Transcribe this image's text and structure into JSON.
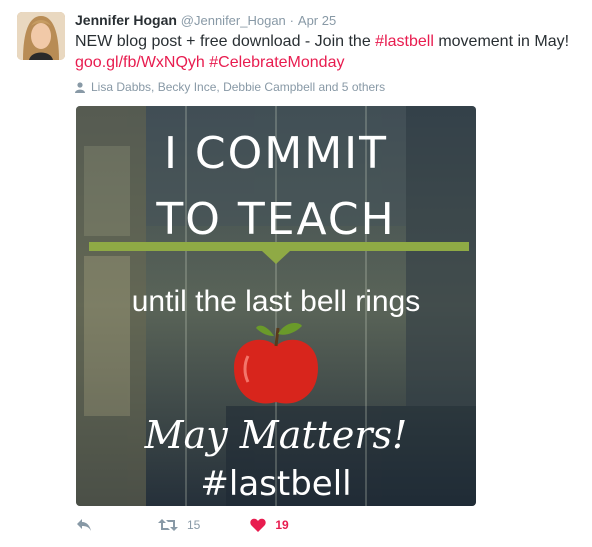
{
  "tweet": {
    "author_name": "Jennifer Hogan",
    "handle": "@Jennifer_Hogan",
    "separator": "·",
    "date": "Apr 25",
    "text_prefix": "NEW blog post + free download - Join the ",
    "hashtag_lastbell": "#lastbell",
    "text_suffix": " movement in May!",
    "link": "goo.gl/fb/WxNQyh",
    "hashtag_celebrate": "#CelebrateMonday",
    "mentioned_users": "Lisa Dabbs, Becky Ince, Debbie Campbell and 5 others"
  },
  "media": {
    "line1": "I COMMIT",
    "line2": "TO TEACH",
    "line3": "until the last bell rings",
    "line4": "May Matters!",
    "line5": "#lastbell"
  },
  "actions": {
    "retweet_count": "15",
    "like_count": "19"
  },
  "colors": {
    "accent": "#e81c4f",
    "muted": "#8899a6",
    "banner_green": "#8faa45",
    "apple_red": "#d8251c"
  }
}
